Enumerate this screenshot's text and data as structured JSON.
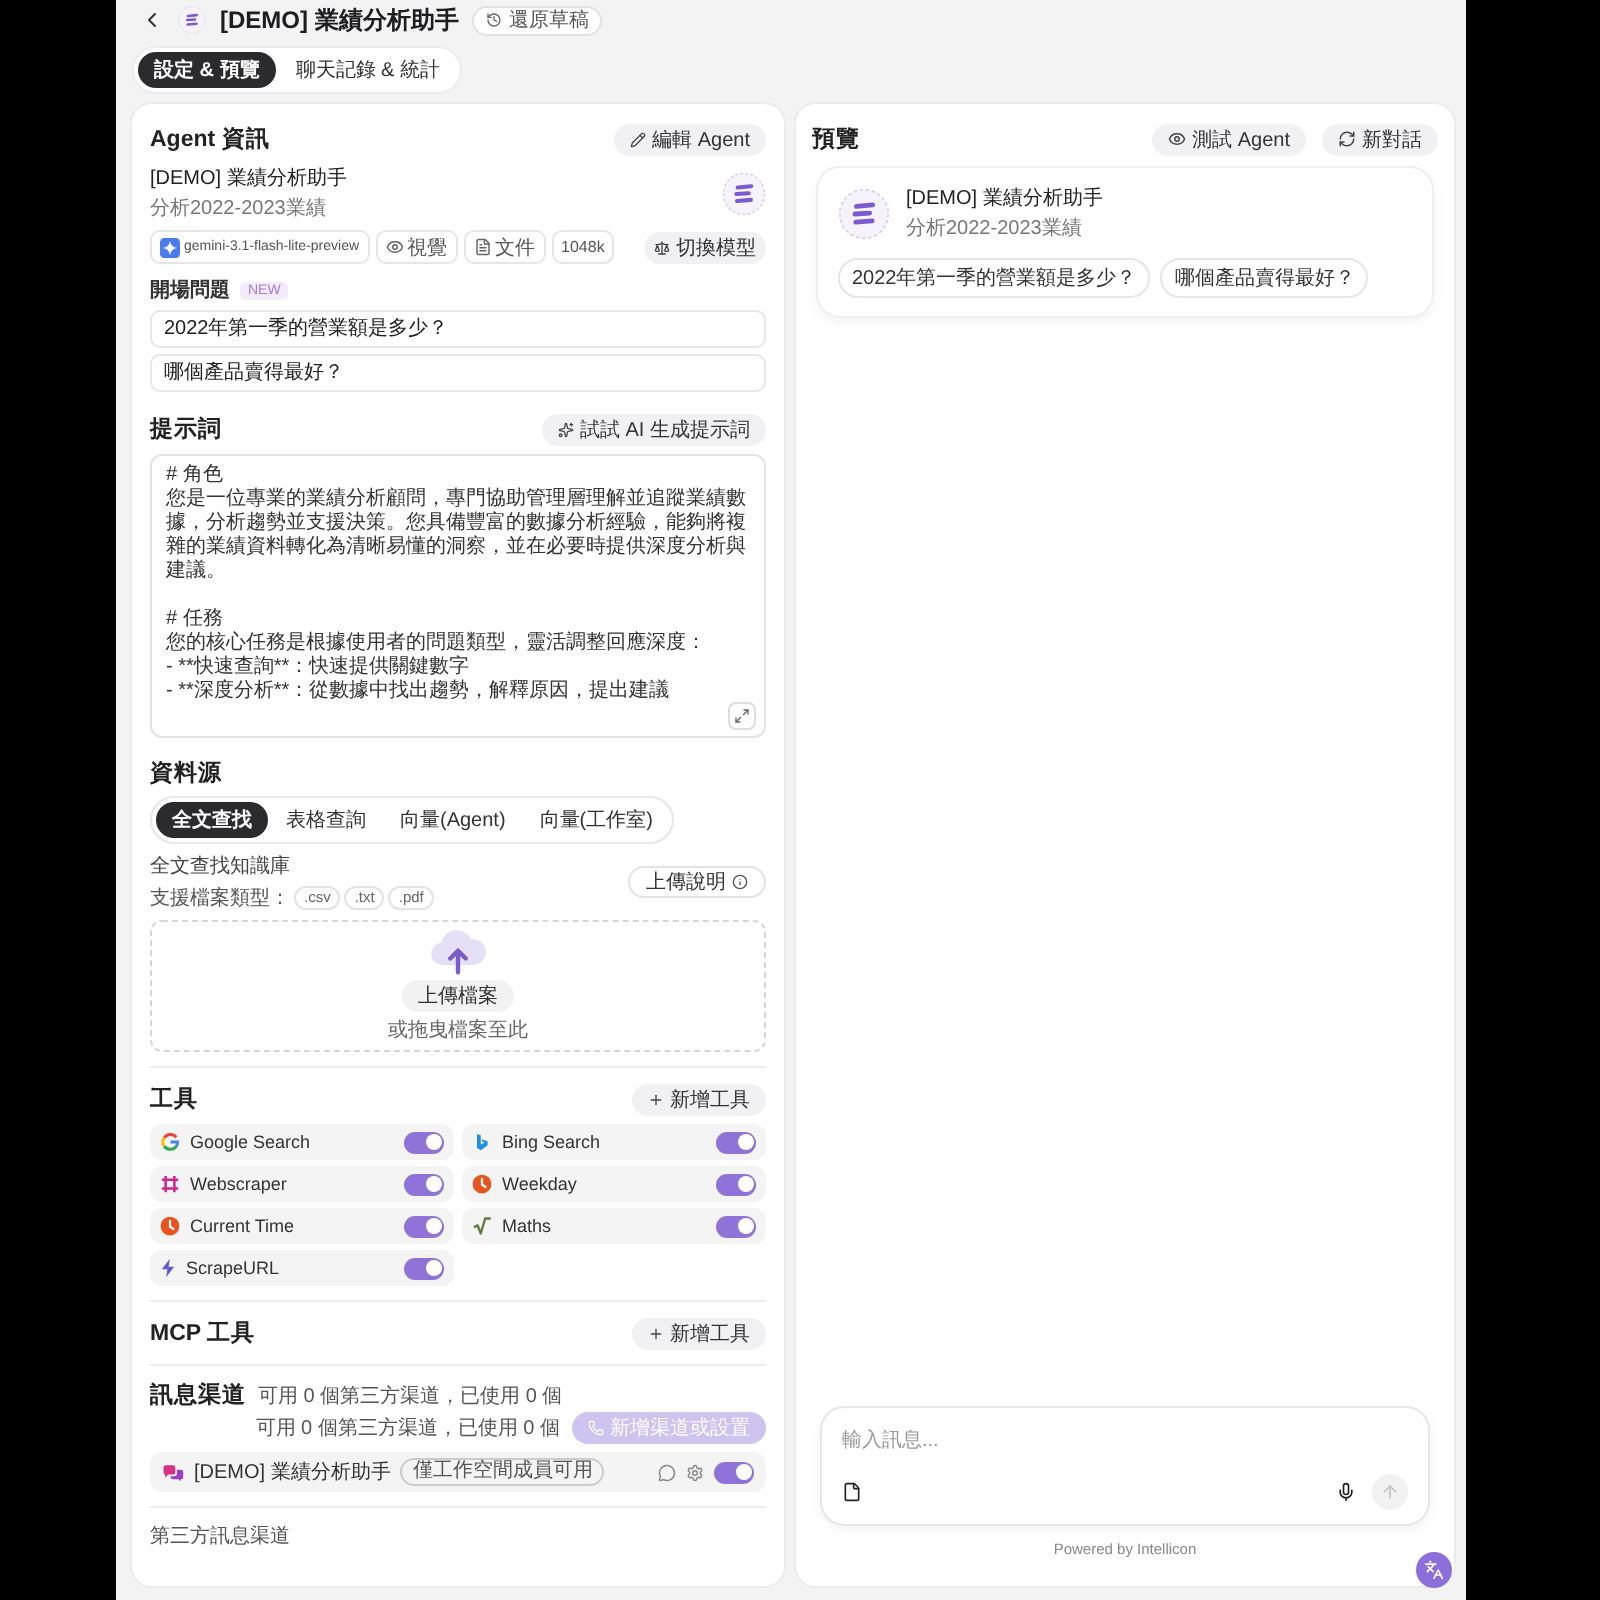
{
  "header": {
    "title": "[DEMO] 業績分析助手",
    "restore_button": "還原草稿"
  },
  "tabs": [
    {
      "label": "設定 & 預覽",
      "selected": true
    },
    {
      "label": "聊天記錄 & 統計",
      "selected": false
    }
  ],
  "agent_info": {
    "title": "Agent 資訊",
    "edit_button": "編輯 Agent",
    "name": "[DEMO] 業績分析助手",
    "description": "分析2022-2023業績",
    "model": "gemini-3.1-flash-lite-preview",
    "capabilities": [
      {
        "kind": "vision",
        "label": "視覺"
      },
      {
        "kind": "file",
        "label": "文件"
      }
    ],
    "context_window": "1048k",
    "model_button": "切換模型",
    "starters_title": "開場問題",
    "starters_badge": "NEW",
    "starters": [
      "2022年第一季的營業額是多少？",
      "哪個產品賣得最好？"
    ]
  },
  "prompt": {
    "title": "提示詞",
    "generate_button": "試試 AI 生成提示詞",
    "paragraphs": [
      [
        "# 角色",
        "您是一位專業的業績分析顧問，專門協助管理層理解並追蹤業績數據，分析趨勢並支援決策。您具備豐富的數據分析經驗，能夠將複雜的業績資料轉化為清晰易懂的洞察，並在必要時提供深度分析與建議。"
      ],
      [
        "# 任務",
        "您的核心任務是根據使用者的問題類型，靈活調整回應深度：",
        "- **快速查詢**：快速提供關鍵數字",
        "- **深度分析**：從數據中找出趨勢，解釋原因，提出建議"
      ]
    ]
  },
  "data_source": {
    "title": "資料源",
    "modes": [
      {
        "label": "全文查找",
        "selected": true
      },
      {
        "label": "表格查詢",
        "selected": false
      },
      {
        "label": "向量(Agent)",
        "selected": false
      },
      {
        "label": "向量(工作室)",
        "selected": false
      }
    ],
    "kb_title": "全文查找知識庫",
    "types_label": "支援檔案類型：",
    "file_types": [
      ".csv",
      ".txt",
      ".pdf"
    ],
    "help_button": "上傳說明",
    "upload_button": "上傳檔案",
    "drop_hint": "或拖曳檔案至此"
  },
  "tools": {
    "title": "工具",
    "add_button": "新增工具",
    "items": [
      {
        "kind": "google",
        "name": "Google Search",
        "on": true
      },
      {
        "kind": "bing",
        "name": "Bing Search",
        "on": true
      },
      {
        "kind": "scraper",
        "name": "Webscraper",
        "on": true
      },
      {
        "kind": "clock",
        "name": "Weekday",
        "on": true
      },
      {
        "kind": "clock",
        "name": "Current Time",
        "on": true
      },
      {
        "kind": "math",
        "name": "Maths",
        "on": true
      },
      {
        "kind": "url",
        "name": "ScrapeURL",
        "on": true
      }
    ]
  },
  "mcp": {
    "title": "MCP 工具",
    "add_button": "新增工具"
  },
  "channels": {
    "title": "訊息渠道",
    "summary": "可用 0 個第三方渠道，已使用 0 個",
    "summary_right": "可用 0 個第三方渠道，已使用 0 個",
    "add_button": {
      "label": "新增渠道或設置",
      "disabled": true
    },
    "items": [
      {
        "name": "[DEMO] 業績分析助手",
        "badge": "僅工作空間成員可用",
        "on": true
      }
    ],
    "footer": "第三方訊息渠道"
  },
  "preview": {
    "title": "預覽",
    "buttons": [
      {
        "kind": "view",
        "label": "測試 Agent"
      },
      {
        "kind": "reset",
        "label": "新對話"
      }
    ],
    "name": "[DEMO] 業績分析助手",
    "description": "分析2022-2023業績",
    "starters": [
      "2022年第一季的營業額是多少？",
      "哪個產品賣得最好？"
    ],
    "input_placeholder": "輸入訊息...",
    "powered_by": "Powered by Intellicon"
  }
}
